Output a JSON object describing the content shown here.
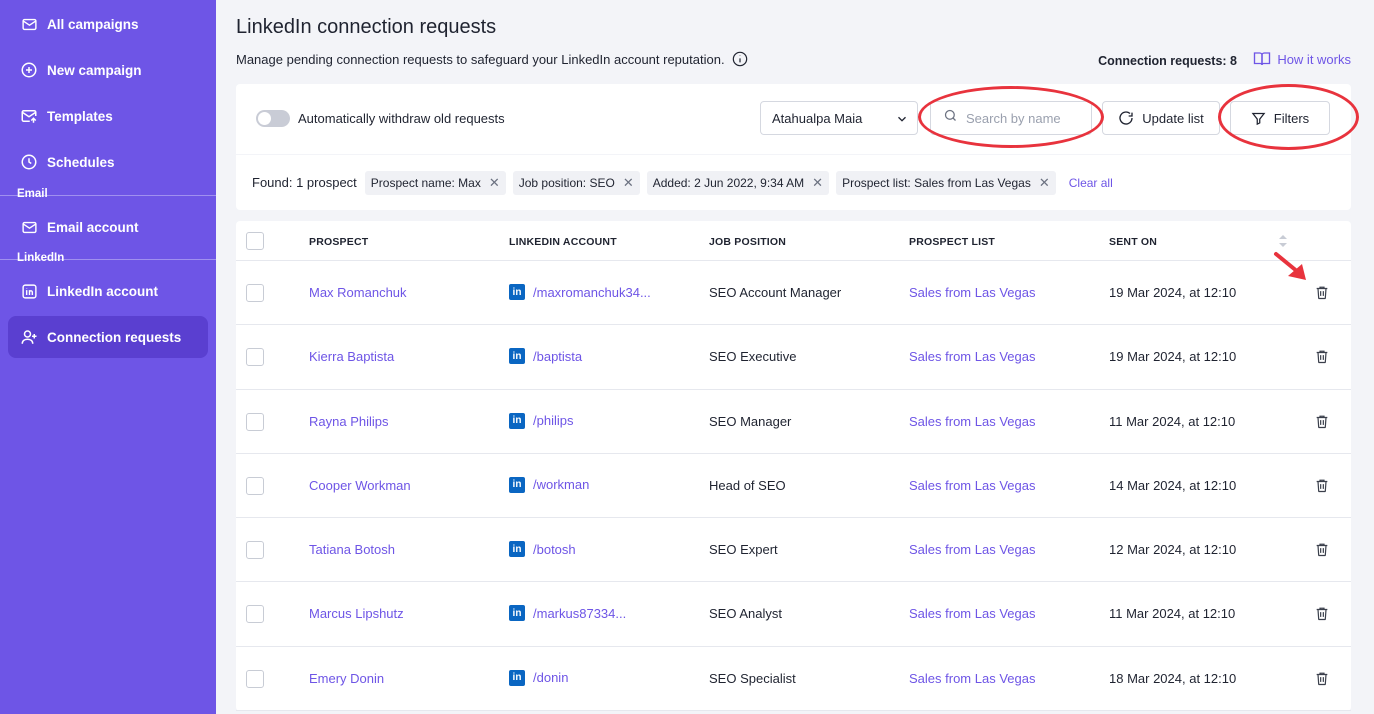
{
  "sidebar": {
    "items": [
      {
        "label": "All campaigns",
        "icon": "mail-icon"
      },
      {
        "label": "New campaign",
        "icon": "plus-circle-icon"
      },
      {
        "label": "Templates",
        "icon": "template-mail-icon"
      },
      {
        "label": "Schedules",
        "icon": "clock-icon"
      },
      {
        "label": "Email account",
        "icon": "mail-icon"
      },
      {
        "label": "LinkedIn account",
        "icon": "linkedin-icon"
      },
      {
        "label": "Connection requests",
        "icon": "add-user-icon"
      }
    ],
    "section_email": "Email",
    "section_linkedin": "LinkedIn"
  },
  "header": {
    "title": "LinkedIn connection requests",
    "subtitle": "Manage pending connection requests to safeguard your LinkedIn account reputation.",
    "connection_count": "Connection requests: 8",
    "how_it_works": "How it works"
  },
  "toolbar": {
    "toggle_label": "Automatically withdraw old requests",
    "account_select": "Atahualpa Maia",
    "search_placeholder": "Search by name",
    "update_label": "Update list",
    "filters_label": "Filters"
  },
  "filters": {
    "found": "Found: 1 prospect",
    "chips": [
      "Prospect name: Max",
      "Job position: SEO",
      "Added: 2 Jun 2022, 9:34 AM",
      "Prospect list: Sales from Las Vegas"
    ],
    "clear_all": "Clear all"
  },
  "table": {
    "headers": [
      "PROSPECT",
      "LINKEDIN ACCOUNT",
      "JOB POSITION",
      "PROSPECT LIST",
      "SENT ON"
    ],
    "rows": [
      {
        "prospect": "Max Romanchuk",
        "linkedin": "/maxromanchuk34...",
        "job": "SEO Account Manager",
        "list": "Sales from Las Vegas",
        "sent": "19 Mar 2024, at 12:10"
      },
      {
        "prospect": "Kierra Baptista",
        "linkedin": "/baptista",
        "job": "SEO Executive",
        "list": "Sales from Las Vegas",
        "sent": "19 Mar 2024, at 12:10"
      },
      {
        "prospect": "Rayna Philips",
        "linkedin": "/philips",
        "job": "SEO Manager",
        "list": "Sales from Las Vegas",
        "sent": "11 Mar 2024, at 12:10"
      },
      {
        "prospect": "Cooper Workman",
        "linkedin": "/workman",
        "job": "Head of SEO",
        "list": "Sales from Las Vegas",
        "sent": "14 Mar 2024, at 12:10"
      },
      {
        "prospect": "Tatiana Botosh",
        "linkedin": "/botosh",
        "job": "SEO Expert",
        "list": "Sales from Las Vegas",
        "sent": "12 Mar 2024, at 12:10"
      },
      {
        "prospect": "Marcus Lipshutz",
        "linkedin": "/markus87334...",
        "job": "SEO Analyst",
        "list": "Sales from Las Vegas",
        "sent": "11 Mar 2024, at 12:10"
      },
      {
        "prospect": "Emery Donin",
        "linkedin": "/donin",
        "job": "SEO Specialist",
        "list": "Sales from Las Vegas",
        "sent": "18 Mar 2024, at 12:10"
      }
    ]
  },
  "colors": {
    "sidebar": "#6e55e6",
    "sidebar_active": "#5a3fd0",
    "accent": "#6e55e6",
    "annotation": "#e8333d",
    "linkedin": "#0a66c2"
  }
}
